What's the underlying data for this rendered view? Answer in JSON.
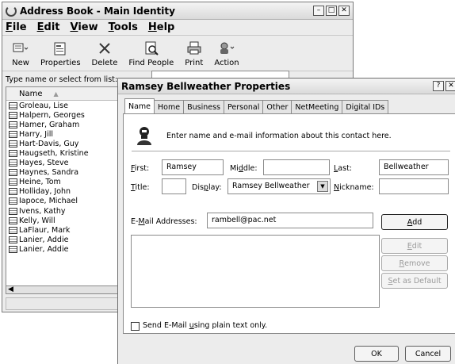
{
  "address_book": {
    "title": "Address Book - Main Identity",
    "menu": [
      {
        "first": "F",
        "rest": "ile"
      },
      {
        "first": "E",
        "rest": "dit"
      },
      {
        "first": "V",
        "rest": "iew"
      },
      {
        "first": "T",
        "rest": "ools"
      },
      {
        "first": "H",
        "rest": "elp"
      }
    ],
    "toolbar": {
      "new_label": "New",
      "properties_label": "Properties",
      "delete_label": "Delete",
      "find_label": "Find People",
      "print_label": "Print",
      "action_label": "Action"
    },
    "type_label": "Type name or select from list:",
    "list_header": "Name",
    "contacts": [
      "Groleau, Lise",
      "Halpern, Georges",
      "Hamer, Graham",
      "Harry, Jill",
      "Hart-Davis, Guy",
      "Haugseth, Kristine",
      "Hayes, Steve",
      "Haynes, Sandra",
      "Heine, Tom",
      "Holliday, John",
      "Iapoce, Michael",
      "Ivens, Kathy",
      "Kelly, Will",
      "LaFlaur, Mark",
      "Lanier, Addie",
      "Lanier, Addie"
    ]
  },
  "dialog": {
    "title": "Ramsey Bellweather Properties",
    "tabs": [
      "Name",
      "Home",
      "Business",
      "Personal",
      "Other",
      "NetMeeting",
      "Digital IDs"
    ],
    "active_tab": "Name",
    "intro": "Enter name and e-mail information about this contact here.",
    "labels": {
      "first": {
        "pre": "",
        "u": "F",
        "post": "irst:"
      },
      "middle": {
        "pre": "Mi",
        "u": "d",
        "post": "dle:"
      },
      "last": {
        "pre": "",
        "u": "L",
        "post": "ast:"
      },
      "title": {
        "pre": "",
        "u": "T",
        "post": "itle:"
      },
      "display": {
        "pre": "Dis",
        "u": "p",
        "post": "lay:"
      },
      "nickname": {
        "pre": "",
        "u": "N",
        "post": "ickname:"
      },
      "email": {
        "pre": "E-",
        "u": "M",
        "post": "ail Addresses:"
      },
      "plain_text": {
        "pre": "Send E-Mail ",
        "u": "u",
        "post": "sing plain text only."
      }
    },
    "values": {
      "first": "Ramsey",
      "middle": "",
      "last": "Bellweather",
      "title": "",
      "display": "Ramsey Bellweather",
      "nickname": "",
      "email": "rambell@pac.net"
    },
    "buttons": {
      "add": {
        "pre": "",
        "u": "A",
        "post": "dd"
      },
      "edit": {
        "pre": "",
        "u": "E",
        "post": "dit"
      },
      "remove": {
        "pre": "",
        "u": "R",
        "post": "emove"
      },
      "set_default": {
        "pre": "",
        "u": "S",
        "post": "et as Default"
      },
      "ok": "OK",
      "cancel": "Cancel"
    }
  }
}
